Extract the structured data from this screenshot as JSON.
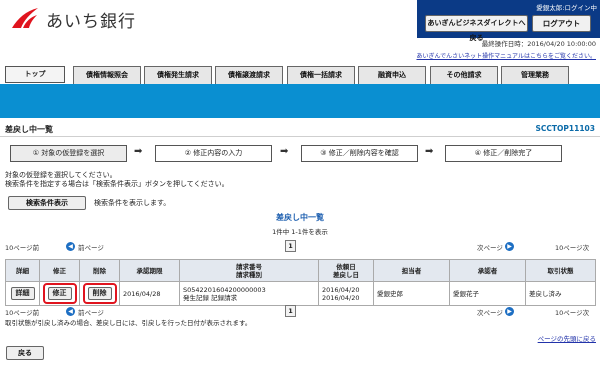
{
  "header": {
    "bank_name": "あいち銀行",
    "user_login": "愛銀太郎:ログイン中",
    "portal_button": "あいぎんビジネスダイレクトへ戻る",
    "logout_button": "ログアウト",
    "last_operation": "最終操作日時：2016/04/20 10:00:00",
    "manual_link": "あいぎんでんさいネット操作マニュアルはこちらをご覧ください。"
  },
  "nav": {
    "top": "トップ",
    "tabs": [
      "債権情報照会",
      "債権発生請求",
      "債権譲渡請求",
      "債権一括請求",
      "融資申込",
      "その他請求",
      "管理業務"
    ]
  },
  "page": {
    "title": "差戻し中一覧",
    "code": "SCCTOP11103"
  },
  "steps": [
    "① 対象の仮登録を選択",
    "② 修正内容の入力",
    "③ 修正／削除内容を確認",
    "④ 修正／削除完了"
  ],
  "arrow": "➡",
  "instructions": [
    "対象の仮登録を選択してください。",
    "検索条件を指定する場合は「検索条件表示」ボタンを押してください。"
  ],
  "search": {
    "button": "検索条件表示",
    "hint": "検索条件を表示します。"
  },
  "list": {
    "title": "差戻し中一覧",
    "count": "1件中 1-1件を表示"
  },
  "pager": {
    "prev10": "10ページ前",
    "prev": "前ページ",
    "page": "1",
    "next": "次ページ",
    "next10": "10ページ次"
  },
  "table": {
    "headers": {
      "detail": "詳細",
      "edit": "修正",
      "delete": "削除",
      "deadline": "承認期限",
      "request_no": "請求番号",
      "request_type": "請求種別",
      "request_date": "依頼日",
      "return_date": "差戻し日",
      "person": "担当者",
      "approver": "承認者",
      "status": "取引状態"
    },
    "rows": [
      {
        "detail_btn": "詳細",
        "edit_btn": "修正",
        "delete_btn": "削除",
        "deadline": "2016/04/28",
        "request_no": "S0542201604200000003",
        "request_type": "発生記録 記録請求",
        "request_date": "2016/04/20",
        "return_date": "2016/04/20",
        "person": "愛銀史郎",
        "approver": "愛銀花子",
        "status": "差戻し済み"
      }
    ]
  },
  "note": "取引状態が引戻し済みの場合、差戻し日には、引戻しを行った日付が表示されます。",
  "page_top_link": "ページの先頭に戻る",
  "back_button": "戻る",
  "colors": {
    "header_navy": "#0b3a86",
    "band_blue": "#0a8fd1",
    "logo_red": "#e0141e",
    "highlight_red": "#e0141e"
  }
}
